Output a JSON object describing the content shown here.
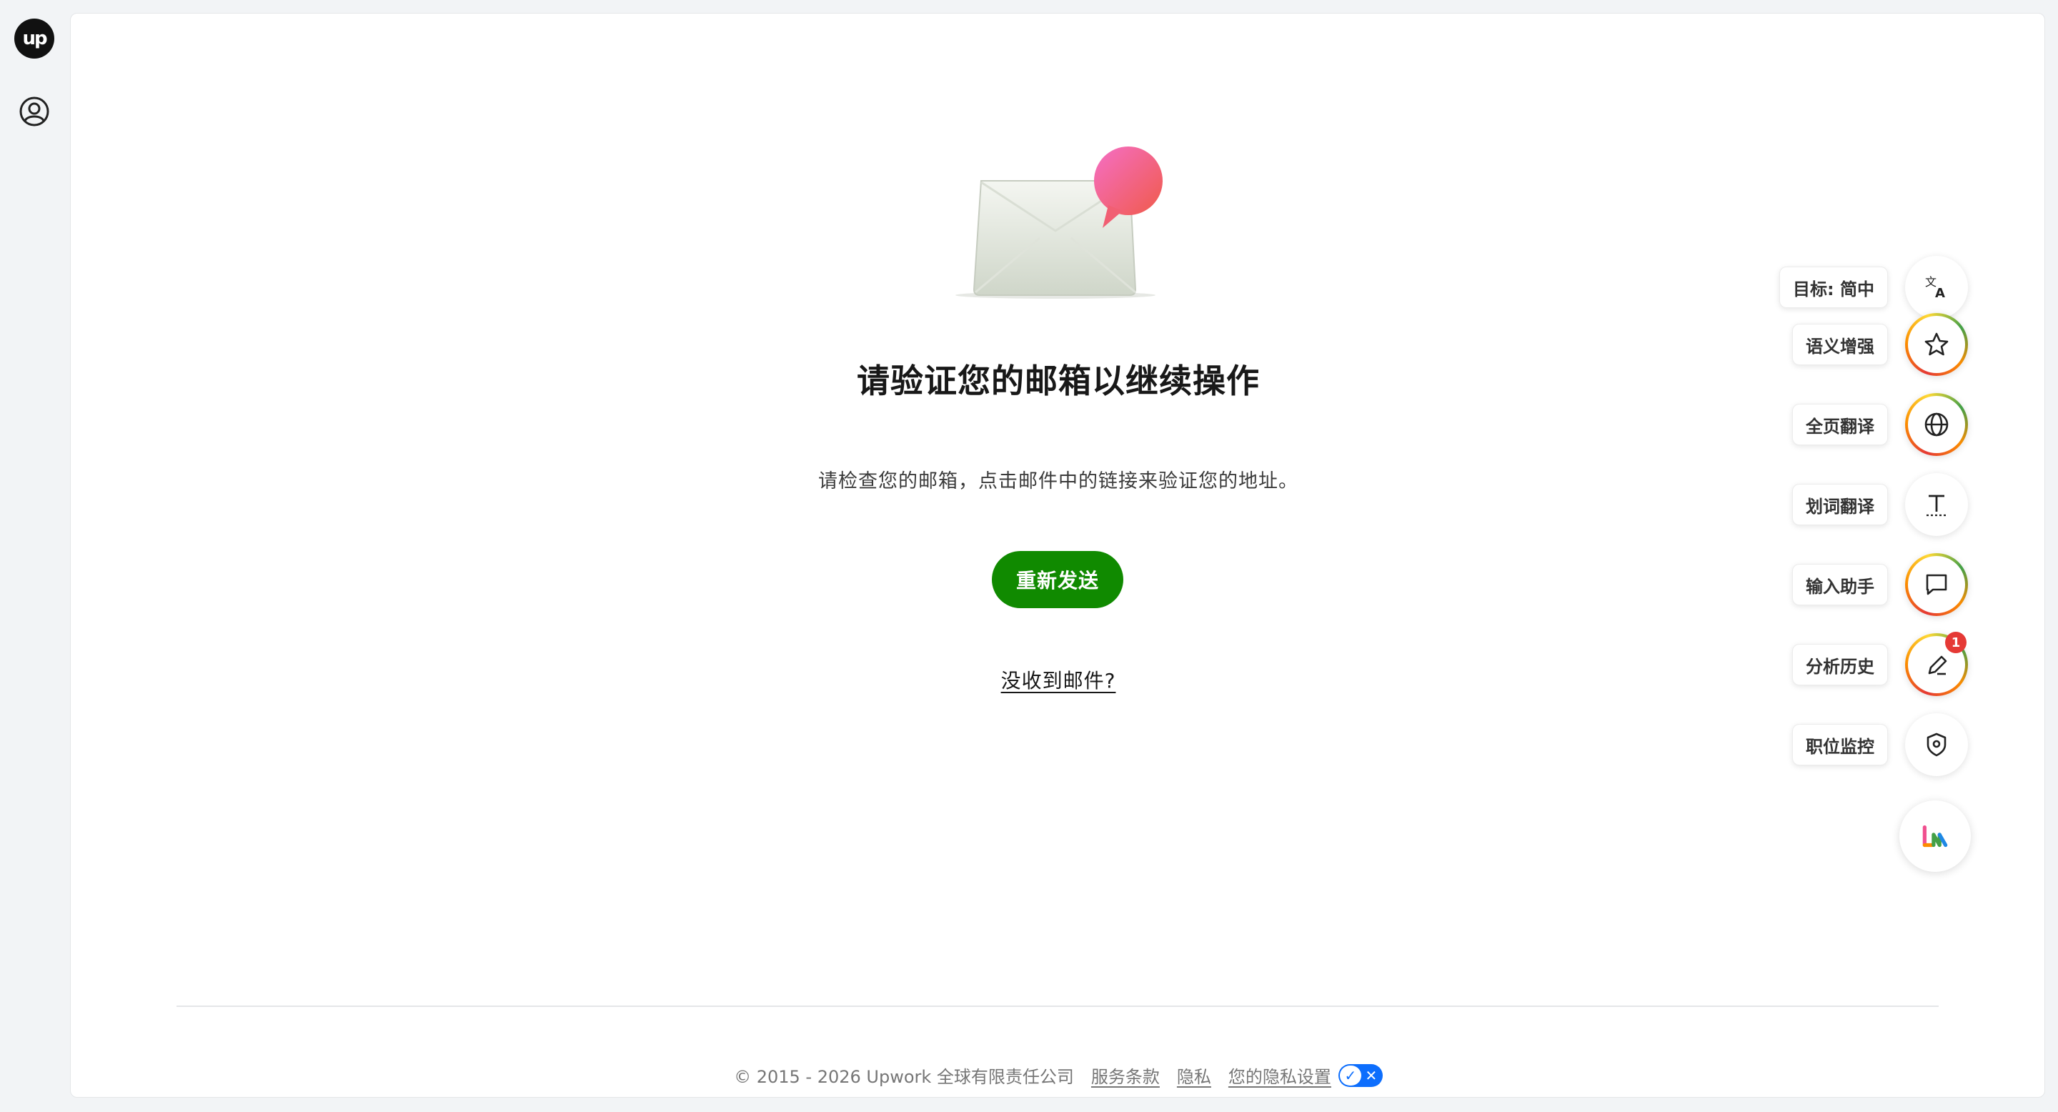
{
  "app": {
    "logo_text": "up"
  },
  "verification": {
    "title": "请验证您的邮箱以继续操作",
    "description": "请检查您的邮箱，点击邮件中的链接来验证您的地址。",
    "resend_label": "重新发送",
    "no_email_label": "没收到邮件?"
  },
  "footer": {
    "copyright": "© 2015 - 2026 Upwork 全球有限责任公司",
    "terms_label": "服务条款",
    "privacy_label": "隐私",
    "privacy_settings_label": "您的隐私设置"
  },
  "translation_toolbar": {
    "items": [
      {
        "label": "目标: 简中",
        "icon": "translate-icon"
      },
      {
        "label": "语义增强",
        "icon": "star-icon"
      },
      {
        "label": "全页翻译",
        "icon": "globe-icon"
      },
      {
        "label": "划词翻译",
        "icon": "text-select-icon"
      },
      {
        "label": "输入助手",
        "icon": "chat-bubble-icon"
      },
      {
        "label": "分析历史",
        "icon": "pen-icon",
        "badge": "1"
      },
      {
        "label": "职位监控",
        "icon": "shield-icon"
      }
    ]
  },
  "colors": {
    "brand_green": "#108a00",
    "toggle_blue": "#0d6efd",
    "badge_red": "#e53935",
    "notification_pink": "#f0508f"
  }
}
